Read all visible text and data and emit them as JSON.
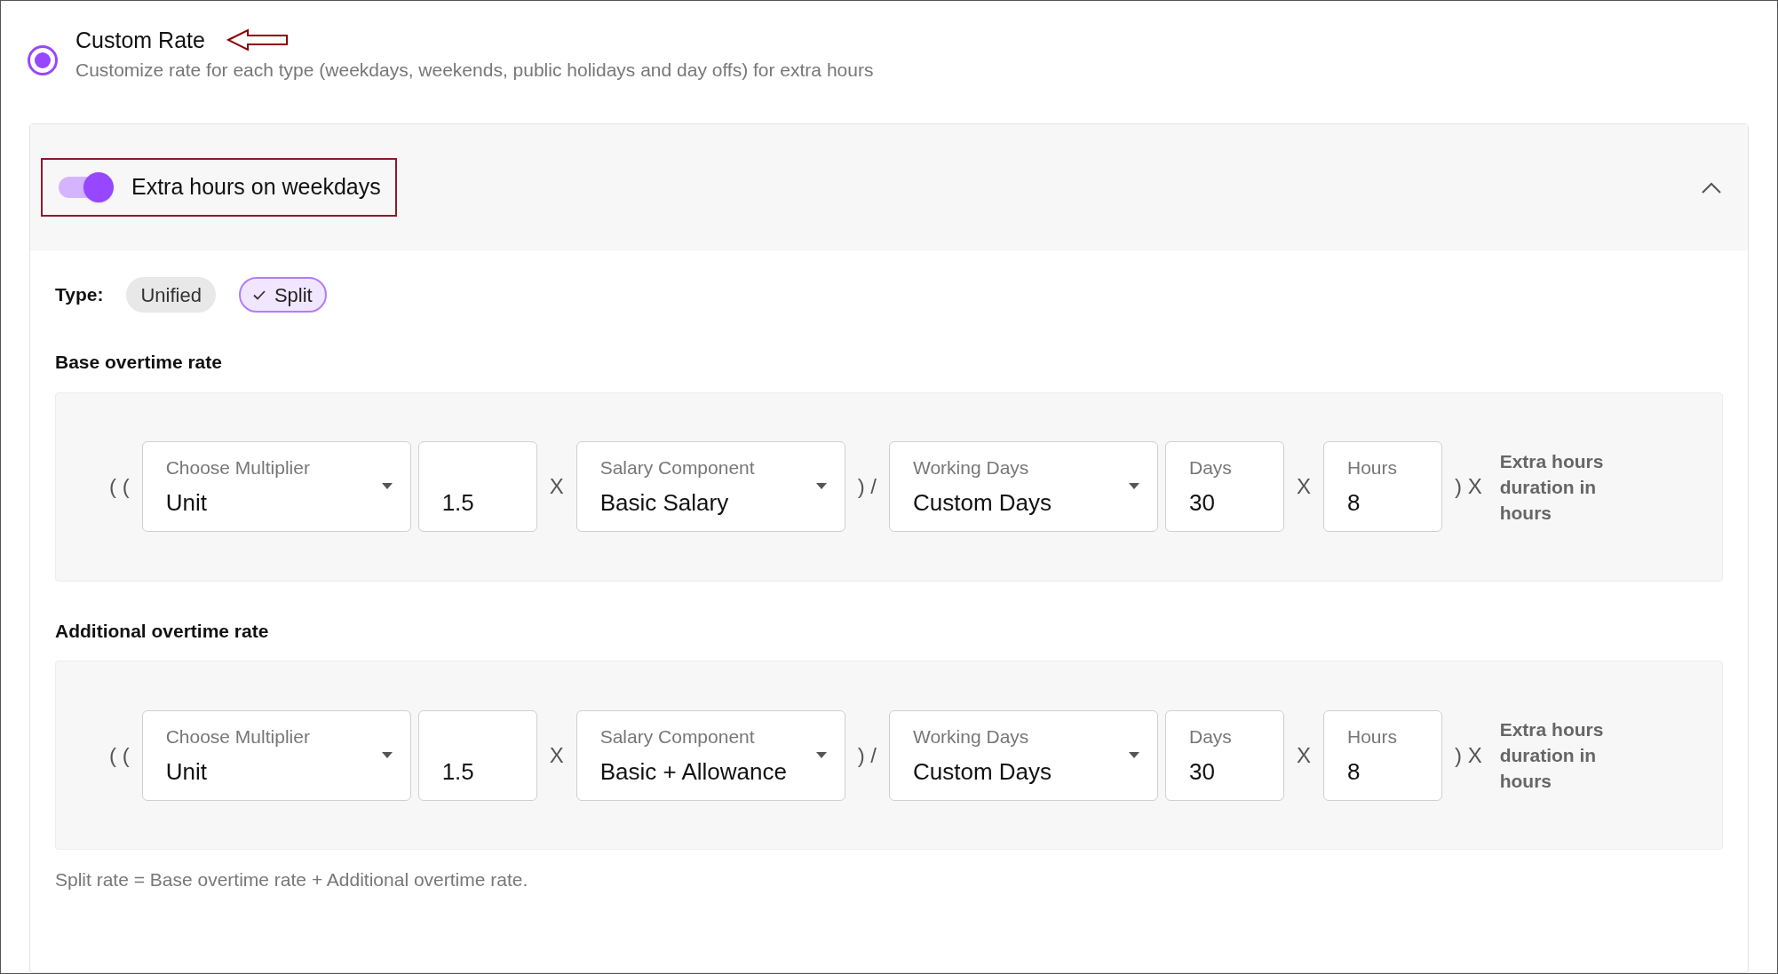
{
  "option": {
    "selected": true,
    "title": "Custom Rate",
    "description": "Customize rate for each type (weekdays, weekends, public holidays and day offs) for extra hours"
  },
  "section": {
    "on": true,
    "title": "Extra hours on weekdays",
    "expanded": true,
    "type_label": "Type:",
    "types": [
      {
        "label": "Unified",
        "selected": false
      },
      {
        "label": "Split",
        "selected": true
      }
    ],
    "rates": [
      {
        "title": "Base overtime rate",
        "formula": [
          {
            "kind": "op",
            "text": "( ("
          },
          {
            "kind": "select",
            "label": "Choose Multiplier",
            "value": "Unit"
          },
          {
            "kind": "input",
            "value": "1.5"
          },
          {
            "kind": "op",
            "text": "X"
          },
          {
            "kind": "select",
            "label": "Salary Component",
            "value": "Basic Salary"
          },
          {
            "kind": "op",
            "text": ") /"
          },
          {
            "kind": "select",
            "label": "Working Days",
            "value": "Custom Days"
          },
          {
            "kind": "input",
            "label": "Days",
            "value": "30"
          },
          {
            "kind": "op",
            "text": "X"
          },
          {
            "kind": "input",
            "label": "Hours",
            "value": "8"
          },
          {
            "kind": "op",
            "text": ") X"
          },
          {
            "kind": "note",
            "text": "Extra hours duration in hours"
          }
        ]
      },
      {
        "title": "Additional overtime rate",
        "formula": [
          {
            "kind": "op",
            "text": "( ("
          },
          {
            "kind": "select",
            "label": "Choose Multiplier",
            "value": "Unit"
          },
          {
            "kind": "input",
            "value": "1.5"
          },
          {
            "kind": "op",
            "text": "X"
          },
          {
            "kind": "select",
            "label": "Salary Component",
            "value": "Basic + Allowance"
          },
          {
            "kind": "op",
            "text": ") /"
          },
          {
            "kind": "select",
            "label": "Working Days",
            "value": "Custom Days"
          },
          {
            "kind": "input",
            "label": "Days",
            "value": "30"
          },
          {
            "kind": "op",
            "text": "X"
          },
          {
            "kind": "input",
            "label": "Hours",
            "value": "8"
          },
          {
            "kind": "op",
            "text": ") X"
          },
          {
            "kind": "note",
            "text": "Extra hours duration in hours"
          }
        ]
      }
    ],
    "note": "Split rate = Base overtime rate + Additional overtime rate."
  }
}
